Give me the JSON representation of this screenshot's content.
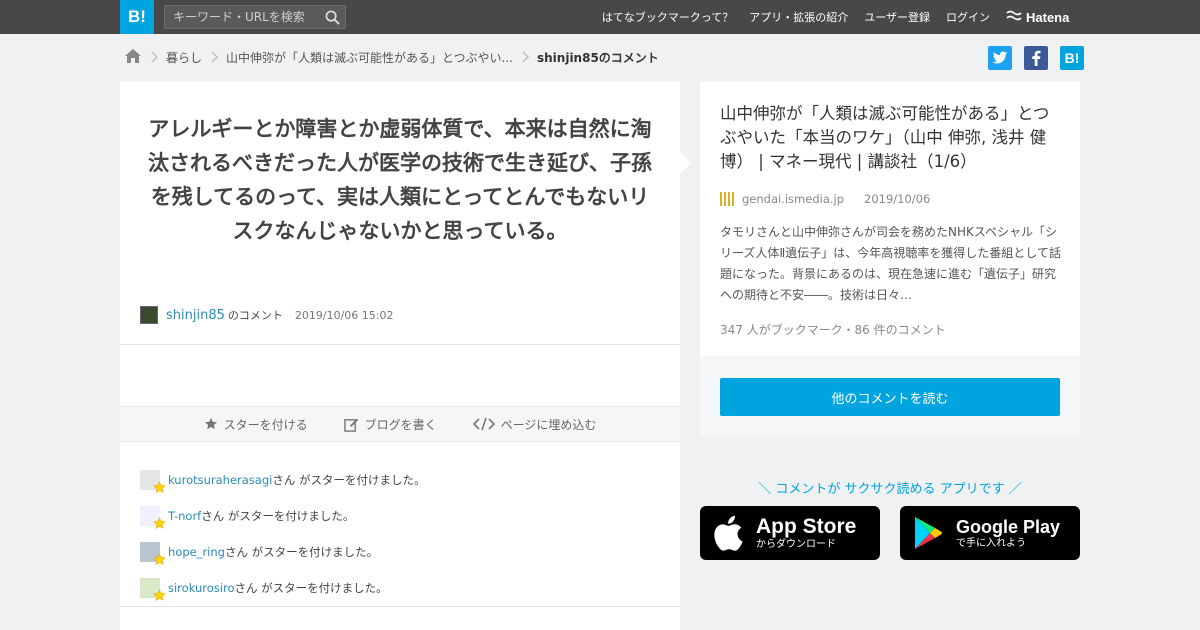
{
  "header": {
    "logo_text": "B!",
    "search_placeholder": "キーワード・URLを検索",
    "nav": [
      "はてなブックマークって？",
      "アプリ・拡張の紹介",
      "ユーザー登録",
      "ログイン"
    ],
    "brand": "Hatena"
  },
  "breadcrumb": {
    "items": [
      "暮らし",
      "山中伸弥が「人類は滅ぶ可能性がある」とつぶやい..."
    ],
    "current": "shinjin85のコメント"
  },
  "share": {
    "hatena_label": "B!"
  },
  "comment": {
    "text": "アレルギーとか障害とか虚弱体質で、本来は自然に淘汰されるべきだった人が医学の技術で生き延び、子孫を残してるのって、実は人類にとってとんでもないリスクなんじゃないかと思っている。",
    "user": "shinjin85",
    "user_suffix": "のコメント",
    "date": "2019/10/06 15:02"
  },
  "actions": {
    "star": "スターを付ける",
    "blog": "ブログを書く",
    "embed": "ページに埋め込む"
  },
  "stars": {
    "suffix": "さん がスターを付けました。",
    "users": [
      "kurotsuraherasagi",
      "T-norf",
      "hope_ring",
      "sirokurosiro"
    ]
  },
  "entry": {
    "title": "山中伸弥が「人類は滅ぶ可能性がある」とつぶやいた「本当のワケ」（山中 伸弥, 浅井 健博） | マネー現代 | 講談社（1/6）",
    "domain": "gendai.ismedia.jp",
    "date": "2019/10/06",
    "summary": "タモリさんと山中伸弥さんが司会を務めたNHKスペシャル「シリーズ人体Ⅱ遺伝子」は、今年高視聴率を獲得した番組として話題になった。背景にあるのは、現在急速に進む「遺伝子」研究への期待と不安――。技術は日々…",
    "counts": "347 人がブックマーク・86 件のコメント",
    "read_more": "他のコメントを読む"
  },
  "promo": {
    "text": "＼ コメントが サクサク読める アプリです ／",
    "app_store": {
      "title": "App Store",
      "sub": "からダウンロード"
    },
    "google_play": {
      "title": "Google Play",
      "sub": "で手に入れよう"
    }
  }
}
